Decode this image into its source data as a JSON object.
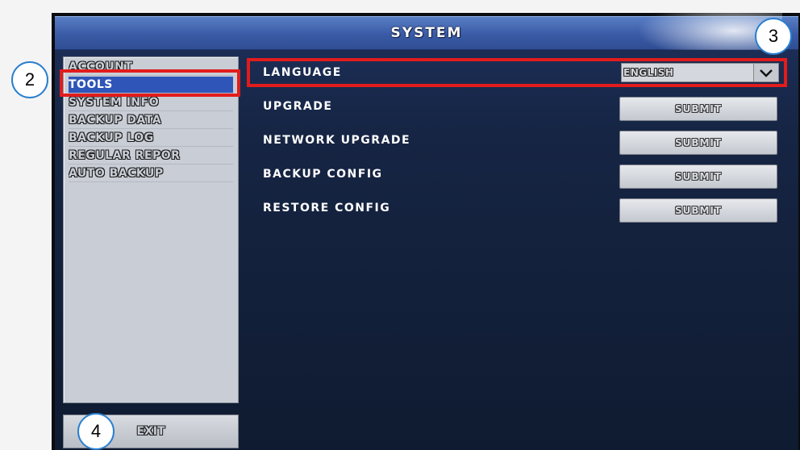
{
  "window": {
    "title": "SYSTEM"
  },
  "sidebar": {
    "items": [
      {
        "label": "ACCOUNT",
        "selected": false
      },
      {
        "label": "TOOLS",
        "selected": true
      },
      {
        "label": "SYSTEM INFO",
        "selected": false
      },
      {
        "label": "BACKUP DATA",
        "selected": false
      },
      {
        "label": "BACKUP LOG",
        "selected": false
      },
      {
        "label": "REGULAR REPOR",
        "selected": false
      },
      {
        "label": "AUTO BACKUP",
        "selected": false
      }
    ],
    "exit_label": "EXIT"
  },
  "main": {
    "language": {
      "label": "LANGUAGE",
      "value": "ENGLISH"
    },
    "rows": [
      {
        "label": "UPGRADE",
        "button": "SUBMIT"
      },
      {
        "label": "NETWORK UPGRADE",
        "button": "SUBMIT"
      },
      {
        "label": "BACKUP CONFIG",
        "button": "SUBMIT"
      },
      {
        "label": "RESTORE CONFIG",
        "button": "SUBMIT"
      }
    ]
  },
  "annotations": {
    "callouts": [
      "2",
      "3",
      "4"
    ],
    "highlight_color": "#e11c1c",
    "callout_border_color": "#2a7fd0"
  },
  "icons": {
    "dropdown": "chevron-down-icon"
  }
}
